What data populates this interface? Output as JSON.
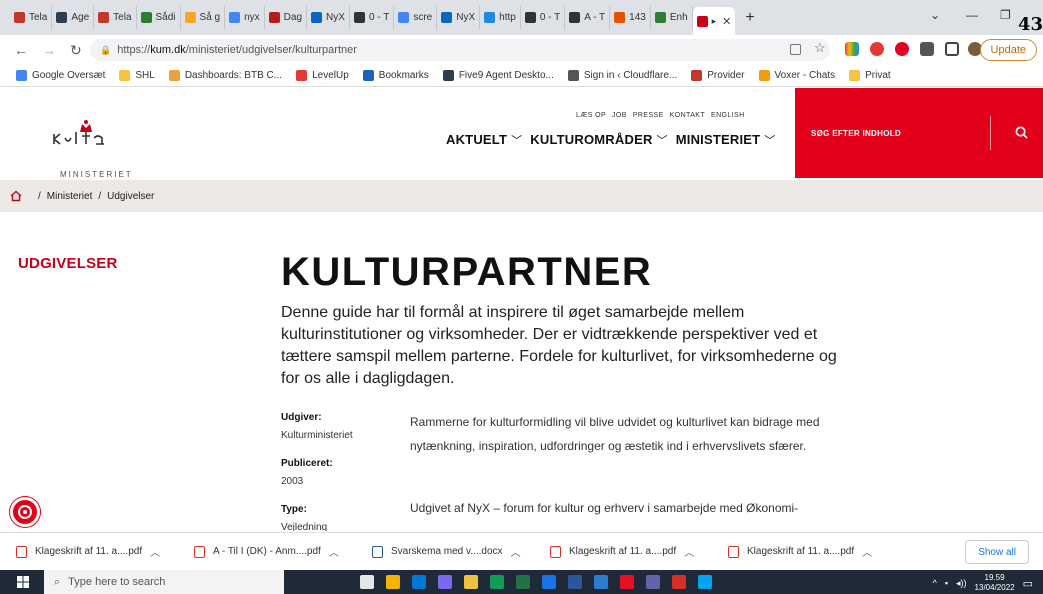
{
  "browser": {
    "tabs": [
      {
        "label": "Tela",
        "color": "#c0392b"
      },
      {
        "label": "Age",
        "color": "#2c3e50"
      },
      {
        "label": "Tela",
        "color": "#c0392b"
      },
      {
        "label": "Sådi",
        "color": "#2e7d32"
      },
      {
        "label": "Så g",
        "color": "#f5a623"
      },
      {
        "label": "nyx",
        "color": "#4285f4"
      },
      {
        "label": "Dag",
        "color": "#b71c1c"
      },
      {
        "label": "NyX",
        "color": "#0a66c2"
      },
      {
        "label": "0 - T",
        "color": "#333"
      },
      {
        "label": "scre",
        "color": "#4285f4"
      },
      {
        "label": "NyX",
        "color": "#0a66c2"
      },
      {
        "label": "http",
        "color": "#1e88e5"
      },
      {
        "label": "0 - T",
        "color": "#333"
      },
      {
        "label": "A - T",
        "color": "#333"
      },
      {
        "label": "143",
        "color": "#e65100"
      },
      {
        "label": "Enh",
        "color": "#2e7d32"
      }
    ],
    "active_tab_color": "#c80017",
    "corner_number": "43",
    "url_prefix": "https://",
    "url_host": "kum.dk",
    "url_path": "/ministeriet/udgivelser/kulturpartner",
    "update_label": "Update",
    "bookmarks": [
      {
        "label": "Google Oversæt",
        "color": "#4285f4"
      },
      {
        "label": "SHL",
        "color": "#f6c342"
      },
      {
        "label": "Dashboards: BTB C...",
        "color": "#e8a33d"
      },
      {
        "label": "LevelUp",
        "color": "#e53935"
      },
      {
        "label": "Bookmarks",
        "color": "#1565c0"
      },
      {
        "label": "Five9 Agent Deskto...",
        "color": "#2c3e50"
      },
      {
        "label": "Sign in ‹ Cloudflare...",
        "color": "#555"
      },
      {
        "label": "Provider",
        "color": "#c0392b"
      },
      {
        "label": "Voxer - Chats",
        "color": "#f39c12"
      },
      {
        "label": "Privat",
        "color": "#f6c342"
      }
    ]
  },
  "site": {
    "logo_text": "MINISTERIET",
    "top_links": [
      "LÆS OP",
      "JOB",
      "PRESSE",
      "KONTAKT",
      "ENGLISH"
    ],
    "main_nav": [
      {
        "label": "AKTUELT"
      },
      {
        "label": "KULTUROMRÅDER"
      },
      {
        "label": "MINISTERIET"
      }
    ],
    "search_label": "SØG EFTER INDHOLD",
    "brand_red": "#e2001a"
  },
  "breadcrumb": {
    "items": [
      "Ministeriet",
      "Udgivelser"
    ]
  },
  "main": {
    "side_title": "UDGIVELSER",
    "title": "KULTURPARTNER",
    "intro": "Denne guide har til formål at inspirere til øget samarbejde mellem kulturinstitutioner og virksomheder. Der er vidtrækkende perspektiver ved et tættere samspil mellem parterne. Fordele for kulturlivet, for virksomhederne og for os alle i dagligdagen.",
    "meta": [
      {
        "key": "Udgiver:",
        "value": "Kulturministeriet"
      },
      {
        "key": "Publiceret:",
        "value": "2003"
      },
      {
        "key": "Type:",
        "value": "Vejledning"
      }
    ],
    "body": "Rammerne for kulturformidling vil blive udvidet og kulturlivet kan bidrage med nytænkning, inspiration, udfordringer og æstetik ind i erhvervslivets sfærer.",
    "body2": "Udgivet af NyX – forum for kultur og erhverv i samarbejde med Økonomi-"
  },
  "downloads": {
    "items": [
      {
        "label": "Klageskrift af 11. a....pdf",
        "kind": "pdf"
      },
      {
        "label": "A - Til I (DK) - Anm....pdf",
        "kind": "pdf"
      },
      {
        "label": "Svarskema med v....docx",
        "kind": "doc"
      },
      {
        "label": "Klageskrift af 11. a....pdf",
        "kind": "pdf"
      },
      {
        "label": "Klageskrift af 11. a....pdf",
        "kind": "pdf"
      }
    ],
    "show_all": "Show all"
  },
  "taskbar": {
    "search_placeholder": "Type here to search",
    "time": "19.59",
    "date": "13/04/2022",
    "apps": [
      "#e6e6e6",
      "#f4b400",
      "#0078d4",
      "#7b68ee",
      "#f0c040",
      "#0f9d58",
      "#217346",
      "#1a73e8",
      "#2b579a",
      "#2b7cd3",
      "#e81123",
      "#6264a7",
      "#d93025",
      "#00a4ef"
    ]
  }
}
